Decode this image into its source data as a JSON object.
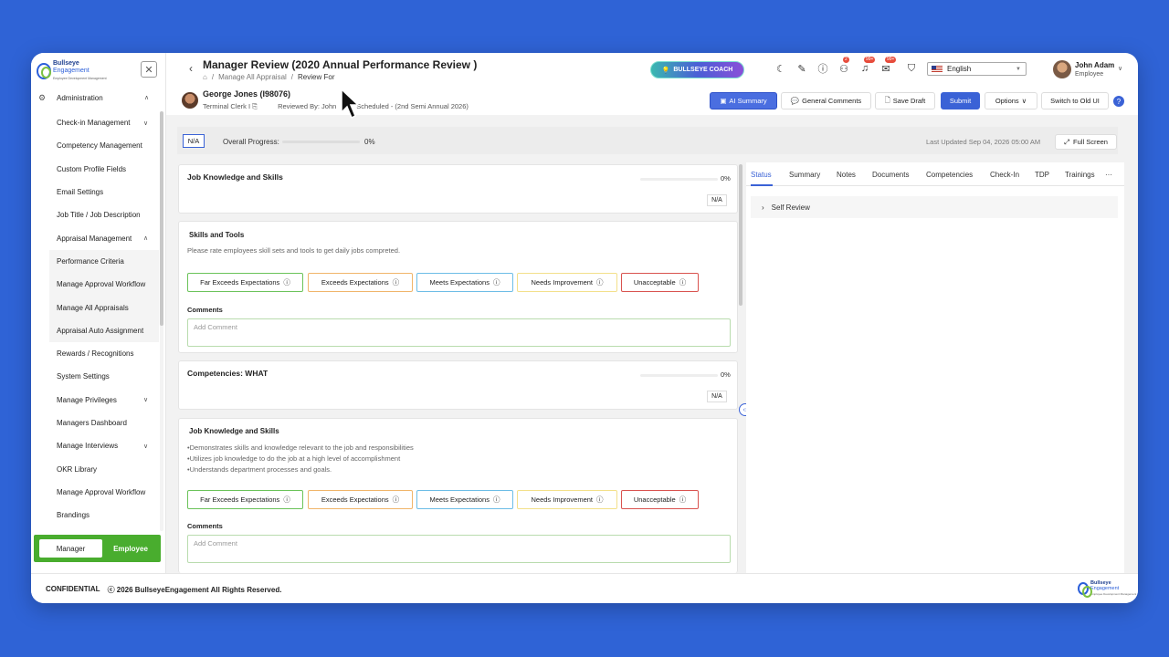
{
  "brand": {
    "line1": "Bullseye",
    "line2": "Engagement",
    "line3": "Employee Development Management"
  },
  "sidebar": {
    "section": "Administration",
    "items": [
      {
        "label": "Check-in Management",
        "chevron": "∨",
        "sub": false
      },
      {
        "label": "Competency Management",
        "chevron": "",
        "sub": false
      },
      {
        "label": "Custom Profile Fields",
        "chevron": "",
        "sub": false
      },
      {
        "label": "Email Settings",
        "chevron": "",
        "sub": false
      },
      {
        "label": "Job Title / Job Description",
        "chevron": "",
        "sub": false
      },
      {
        "label": "Appraisal Management",
        "chevron": "∧",
        "sub": false
      },
      {
        "label": "Performance Criteria",
        "chevron": "",
        "sub": true
      },
      {
        "label": "Manage Approval Workflow",
        "chevron": "",
        "sub": true
      },
      {
        "label": "Manage All Appraisals",
        "chevron": "",
        "sub": true
      },
      {
        "label": "Appraisal Auto Assignment",
        "chevron": "",
        "sub": true
      },
      {
        "label": "Rewards / Recognitions",
        "chevron": "",
        "sub": false
      },
      {
        "label": "System Settings",
        "chevron": "",
        "sub": false
      },
      {
        "label": "Manage Privileges",
        "chevron": "∨",
        "sub": false
      },
      {
        "label": "Managers Dashboard",
        "chevron": "",
        "sub": false
      },
      {
        "label": "Manage Interviews",
        "chevron": "∨",
        "sub": false
      },
      {
        "label": "OKR Library",
        "chevron": "",
        "sub": false
      },
      {
        "label": "Manage Approval Workflow",
        "chevron": "",
        "sub": false
      },
      {
        "label": "Brandings",
        "chevron": "",
        "sub": false
      }
    ],
    "role_manager": "Manager",
    "role_employee": "Employee"
  },
  "header": {
    "title": "Manager Review (2020 Annual Performance Review )",
    "breadcrumb": [
      "Manage All Appraisal",
      "Review For"
    ],
    "coach_label": "BULLSEYE COACH",
    "badges": [
      "2",
      "99+",
      "99+"
    ],
    "language": "English",
    "user_name": "John Adam",
    "user_role": "Employee"
  },
  "employee": {
    "name": "George Jones (I98076)",
    "position": "Terminal Clerk I",
    "reviewed_by": "Reviewed By: John",
    "scheduled": "Scheduled - (2nd Semi Annual 2026)"
  },
  "toolbar": {
    "ai_summary": "AI Summary",
    "general_comments": "General Comments",
    "save_draft": "Save Draft",
    "submit": "Submit",
    "options": "Options",
    "switch_old": "Switch to Old UI",
    "help": "?"
  },
  "progress": {
    "na": "N/A",
    "label": "Overall Progress:",
    "percent": "0%",
    "last_updated": "Last Updated Sep 04, 2026 05:00 AM",
    "full_screen": "Full Screen"
  },
  "ratings": [
    "Far Exceeds Expectations",
    "Exceeds Expectations",
    "Meets Expectations",
    "Needs Improvement",
    "Unacceptable"
  ],
  "sections": [
    {
      "title": "Job Knowledge and Skills",
      "percent": "0%",
      "na": "N/A",
      "sub_title": "Skills and Tools",
      "desc": "Please rate employees skill sets and tools to get daily jobs compreted.",
      "comments_label": "Comments",
      "comment_placeholder": "Add Comment"
    },
    {
      "title": "Competencies: WHAT",
      "percent": "0%",
      "na": "N/A",
      "sub_title": "Job Knowledge and Skills",
      "desc_lines": [
        "•Demonstrates skills and knowledge relevant to the job and responsibilities",
        "•Utilizes job knowledge to do the job at a high level of accomplishment",
        "•Understands department processes and goals."
      ],
      "comments_label": "Comments",
      "comment_placeholder": "Add Comment"
    }
  ],
  "right_panel": {
    "tabs": [
      "Status",
      "Summary",
      "Notes",
      "Documents",
      "Competencies",
      "Check-In",
      "TDP",
      "Trainings",
      "···"
    ],
    "self_review": "Self Review"
  },
  "footer": {
    "confidential": "CONFIDENTIAL",
    "copyright": "ⓒ 2026 BullseyeEngagement All Rights Reserved."
  },
  "colors": {
    "accent": "#3a62d6",
    "green": "#49ad2e",
    "background": "#2f63d6"
  }
}
